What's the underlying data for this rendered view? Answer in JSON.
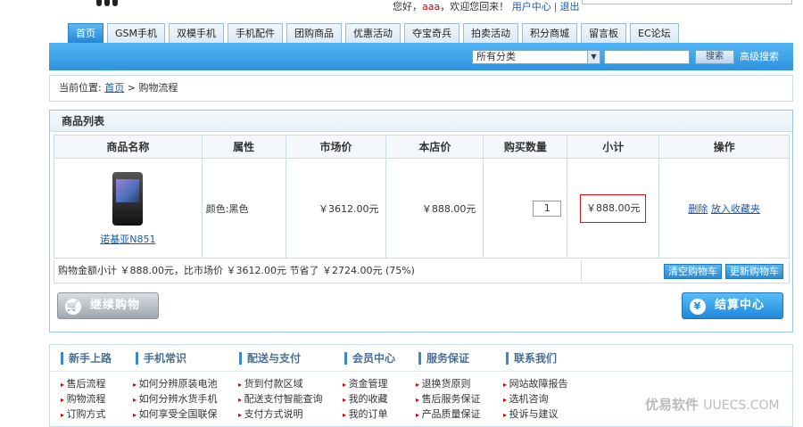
{
  "topbar": {
    "greeting": "您好，",
    "username": "aaa",
    "welcome": "，欢迎您回来！",
    "user_center": "用户中心",
    "separator": "|",
    "logout": "退出"
  },
  "nav": {
    "tabs": [
      "首页",
      "GSM手机",
      "双模手机",
      "手机配件",
      "团购商品",
      "优惠活动",
      "夺宝奇兵",
      "拍卖活动",
      "积分商城",
      "留言板",
      "EC论坛"
    ],
    "active": "首页"
  },
  "search": {
    "category": "所有分类",
    "button": "搜索",
    "advanced": "高级搜索"
  },
  "breadcrumb": {
    "prefix": "当前位置:",
    "home": "首页",
    "arrow": ">",
    "current": "购物流程"
  },
  "cart": {
    "title": "商品列表",
    "headers": [
      "商品名称",
      "属性",
      "市场价",
      "本店价",
      "购买数量",
      "小计",
      "操作"
    ],
    "row": {
      "name": "诺基亚N851",
      "attribute": "颜色:黑色",
      "market_price": "￥3612.00元",
      "shop_price": "￥888.00元",
      "quantity": "1",
      "subtotal": "￥888.00元",
      "delete": "删除",
      "favorite": "放入收藏夹"
    },
    "summary": "购物金额小计 ￥888.00元，比市场价 ￥3612.00元 节省了 ￥2724.00元 (75%)",
    "clear_button": "清空购物车",
    "update_button": "更新购物车",
    "continue_button": "继续购物",
    "checkout_button": "结算中心"
  },
  "help": {
    "columns": [
      {
        "title": "新手上路",
        "items": [
          "售后流程",
          "购物流程",
          "订购方式"
        ]
      },
      {
        "title": "手机常识",
        "items": [
          "如何分辨原装电池",
          "如何分辨水货手机",
          "如何享受全国联保"
        ]
      },
      {
        "title": "配送与支付",
        "items": [
          "货到付款区域",
          "配送支付智能查询",
          "支付方式说明"
        ]
      },
      {
        "title": "会员中心",
        "items": [
          "资金管理",
          "我的收藏",
          "我的订单"
        ]
      },
      {
        "title": "服务保证",
        "items": [
          "退换货原则",
          "售后服务保证",
          "产品质量保证"
        ]
      },
      {
        "title": "联系我们",
        "items": [
          "网站故障报告",
          "选机咨询",
          "投诉与建议"
        ]
      }
    ]
  },
  "watermark": {
    "cn": "优易软件",
    "en": "UUECS.COM"
  },
  "colors": {
    "accent": "#2e93de",
    "link": "#1d58a6",
    "highlight": "#e01010"
  }
}
